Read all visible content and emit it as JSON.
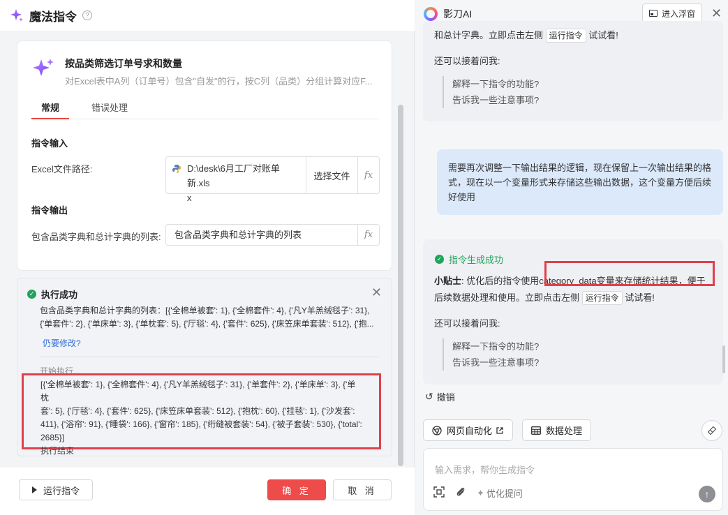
{
  "left_panel": {
    "title": "魔法指令",
    "help_icon": "?",
    "card": {
      "title": "按品类筛选订单号求和数量",
      "description": "对Excel表中A列（订单号）包含\"自发\"的行，按C列（品类）分组计算对应F...",
      "tabs": [
        "常规",
        "错误处理"
      ],
      "input_section": "指令输入",
      "excel_label": "Excel文件路径:",
      "excel_path_line1": "D:\\desk\\6月工厂对账单新.xls",
      "excel_path_line2": "x",
      "choose_file": "选择文件",
      "fx": "fx",
      "output_section": "指令输出",
      "output_label": "包含品类字典和总计字典的列表:",
      "output_value": "包含品类字典和总计字典的列表"
    },
    "result": {
      "title": "执行成功",
      "close": "✕",
      "line1": "包含品类字典和总计字典的列表：[{'全棉单被套': 1}, {'全棉套件': 4}, {'凡Y羊羔绒毯子': 31},",
      "line2": "{'单套件': 2}, {'单床单': 3}, {'单枕套': 5}, {'厅毯': 4}, {'套件': 625}, {'床笠床单套装': 512}, {'抱...",
      "modify_link": "仍要修改?",
      "start_exec": "开始执行...",
      "log_line1": "[{'全棉单被套': 1}, {'全棉套件': 4}, {'凡Y羊羔绒毯子': 31}, {'单套件': 2}, {'单床单': 3}, {'单枕",
      "log_line2": "套': 5}, {'厅毯': 4}, {'套件': 625}, {'床笠床单套装': 512}, {'抱枕': 60}, {'挂毯': 1}, {'沙发套':",
      "log_line3": "411}, {'浴帘': 91}, {'睡袋': 166}, {'窗帘': 185}, {'绗缝被套装': 54}, {'被子套装': 530}, {'total':",
      "log_line4": "2685}]",
      "log_end": "执行结束"
    },
    "footer": {
      "run": "运行指令",
      "ok": "确 定",
      "cancel": "取 消"
    }
  },
  "right_panel": {
    "app_name": "影刀AI",
    "float_btn": "进入浮窗",
    "close": "✕",
    "bubble1": {
      "cut_text_prefix": "和总计字典。立即点击左侧",
      "run_tag": "运行指令",
      "cut_text_suffix": "试试看!",
      "ask": "还可以接着问我:",
      "q1": "解释一下指令的功能?",
      "q2": "告诉我一些注意事项?"
    },
    "user_message": "需要再次调整一下输出结果的逻辑，现在保留上一次输出结果的格式，现在以一个变量形式来存储这些输出数据，这个变量方便后续好使用",
    "bubble2": {
      "gen_ok": "指令生成成功",
      "tip_label": "小贴士",
      "tip_text": ": 优化后的指令使用category_data变量来存储统计结果，便于后续数据处理和使用。立即点击左侧",
      "run_tag": "运行指令",
      "tip_suffix": "试试看!",
      "ask": "还可以接着问我:",
      "q1": "解释一下指令的功能?",
      "q2": "告诉我一些注意事项?"
    },
    "undo": "撤销",
    "tools": [
      "网页自动化",
      "数据处理"
    ],
    "input_placeholder": "输入需求，帮你生成指令",
    "optimize": "优化提问"
  }
}
